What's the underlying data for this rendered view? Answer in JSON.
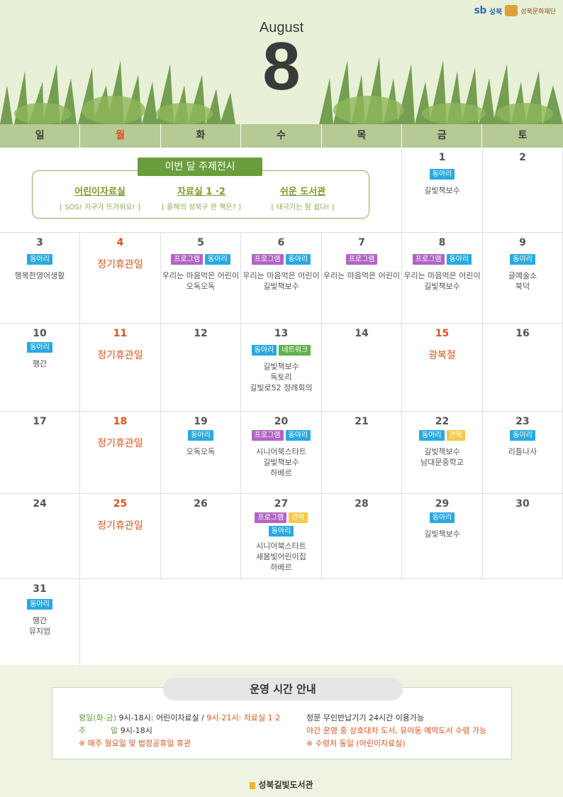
{
  "header": {
    "logo_sb": "sb",
    "logo_sb_sub": "성북",
    "logo_foundation": "성북문화재단",
    "month_name": "August",
    "month_number": "8"
  },
  "weekdays": [
    {
      "label": "일",
      "red": false
    },
    {
      "label": "월",
      "red": true
    },
    {
      "label": "화",
      "red": false
    },
    {
      "label": "수",
      "red": false
    },
    {
      "label": "목",
      "red": false
    },
    {
      "label": "금",
      "red": false
    },
    {
      "label": "토",
      "red": false
    }
  ],
  "theme": {
    "title": "이번 달 주제전시",
    "items": [
      {
        "name": "어린이자료실",
        "sub": "[  SOS! 지구가 뜨거워요!  ]"
      },
      {
        "name": "자료실 1 ·2",
        "sub": "[  올해의 성북구 한 책은?  ]"
      },
      {
        "name": "쉬운 도서관",
        "sub": "[  태극기는 참 쉽다!  ]"
      }
    ]
  },
  "days": {
    "d1": {
      "num": "1",
      "tags": [
        "동아리"
      ],
      "events": [
        "길빛책보수"
      ]
    },
    "d2": {
      "num": "2"
    },
    "d3": {
      "num": "3",
      "tags": [
        "동아리"
      ],
      "events": [
        "행복한영어생활"
      ]
    },
    "d4": {
      "num": "4",
      "closed": "정기휴관일"
    },
    "d5": {
      "num": "5",
      "tags": [
        "프로그램",
        "동아리"
      ],
      "events": [
        "우리는 마음먹은 어린이",
        "오독오독"
      ]
    },
    "d6": {
      "num": "6",
      "tags": [
        "프로그램",
        "동아리"
      ],
      "events": [
        "우리는 마음먹은 어린이",
        "길빛책보수"
      ]
    },
    "d7": {
      "num": "7",
      "tags": [
        "프로그램"
      ],
      "events": [
        "우리는 마음먹은 어린이"
      ]
    },
    "d8": {
      "num": "8",
      "tags": [
        "프로그램",
        "동아리"
      ],
      "events": [
        "우리는 마음먹은 어린이",
        "길빛책보수"
      ]
    },
    "d9": {
      "num": "9",
      "tags": [
        "동아리"
      ],
      "events": [
        "글예술소",
        "북덕"
      ]
    },
    "d10": {
      "num": "10",
      "tags": [
        "동아리"
      ],
      "events": [
        "행간"
      ]
    },
    "d11": {
      "num": "11",
      "closed": "정기휴관일"
    },
    "d12": {
      "num": "12"
    },
    "d13": {
      "num": "13",
      "tags": [
        "동아리",
        "네트워크"
      ],
      "events": [
        "길빛책보수",
        "독토리",
        "길빛로52 정례회의"
      ]
    },
    "d14": {
      "num": "14"
    },
    "d15": {
      "num": "15",
      "closed": "광복절"
    },
    "d16": {
      "num": "16"
    },
    "d17": {
      "num": "17"
    },
    "d18": {
      "num": "18",
      "closed": "정기휴관일"
    },
    "d19": {
      "num": "19",
      "tags": [
        "동아리"
      ],
      "events": [
        "오독오독"
      ]
    },
    "d20": {
      "num": "20",
      "tags": [
        "프로그램",
        "동아리"
      ],
      "events": [
        "시니어북스타트",
        "길빛책보수",
        "하베르"
      ]
    },
    "d21": {
      "num": "21"
    },
    "d22": {
      "num": "22",
      "tags": [
        "동아리",
        "견학"
      ],
      "events": [
        "길빛책보수",
        "남대문중학교"
      ]
    },
    "d23": {
      "num": "23",
      "tags": [
        "동아리"
      ],
      "events": [
        "리틀나사"
      ]
    },
    "d24": {
      "num": "24"
    },
    "d25": {
      "num": "25",
      "closed": "정기휴관일"
    },
    "d26": {
      "num": "26"
    },
    "d27": {
      "num": "27",
      "tags": [
        "프로그램",
        "견학"
      ],
      "tags2": [
        "동아리"
      ],
      "events": [
        "시니어북스타트",
        "새봄빛어린이집",
        "하베르"
      ]
    },
    "d28": {
      "num": "28"
    },
    "d29": {
      "num": "29",
      "tags": [
        "동아리"
      ],
      "events": [
        "길빛책보수"
      ]
    },
    "d30": {
      "num": "30"
    },
    "d31": {
      "num": "31",
      "tags": [
        "동아리"
      ],
      "events": [
        "행간",
        "뮤지엄"
      ]
    }
  },
  "hours": {
    "title": "운영 시간 안내",
    "weekday_label": "평일(화-금)",
    "weekday_1": "9시-18시: 어린이자료실",
    "sep": " / ",
    "weekday_2": "9시-21시: 자료실 1·2",
    "weekend_label": "주          말",
    "weekend_hours": "9시-18시",
    "closed_note": "※ 매주 월요일 및 법정공휴일 휴관",
    "return_note": "정문 무인반납기기 24시간 이용가능",
    "night_note": "야간 운영 중 상호대차 도서, 유아동 예약도서 수령 가능",
    "pickup_note": "※ 수령처 동일 (어린이자료실)"
  },
  "footer": {
    "library_name": "성북길빛도서관"
  },
  "colors": {
    "tag_club": "#29a9e1",
    "tag_program": "#b264c4",
    "tag_network": "#63b04d",
    "tag_visit": "#f6c94a",
    "holiday": "#d9531e"
  }
}
